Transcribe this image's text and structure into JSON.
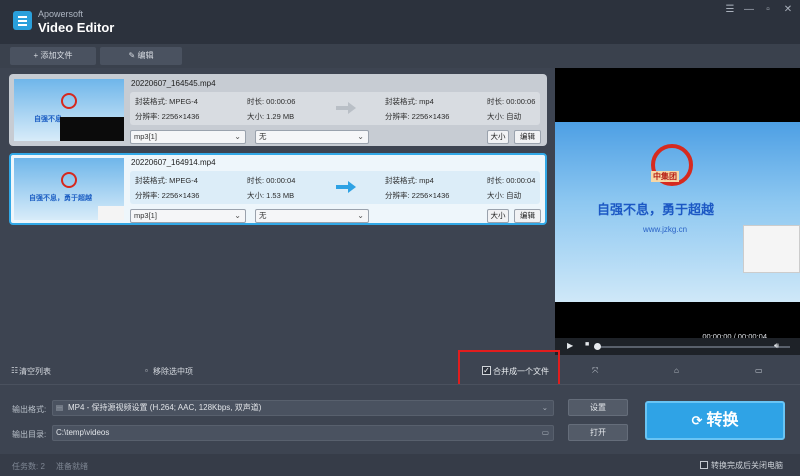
{
  "app": {
    "brand": "Apowersoft",
    "title": "Video Editor"
  },
  "window": {
    "minimize": "—",
    "restore": "▫",
    "close": "✕",
    "menu": "☰"
  },
  "toolbar": {
    "add_files": "+ 添加文件",
    "edit": "✎ 编辑"
  },
  "files": [
    {
      "name": "20220607_164545.mp4",
      "src_format_label": "封装格式: MPEG-4",
      "src_duration": "时长: 00:00:06",
      "src_resolution": "分辨率: 2256×1436",
      "src_size": "大小: 1.29 MB",
      "out_format_label": "封装格式: mp4",
      "out_duration": "时长: 00:00:06",
      "out_resolution": "分辨率: 2256×1436",
      "out_size": "大小: 自动",
      "audio": "mp3[1]",
      "subtitle": "无",
      "size_btn": "大小",
      "edit_btn": "编辑",
      "thumb_slogan": "自强不息",
      "selected": false
    },
    {
      "name": "20220607_164914.mp4",
      "src_format_label": "封装格式: MPEG-4",
      "src_duration": "时长: 00:00:04",
      "src_resolution": "分辨率: 2256×1436",
      "src_size": "大小: 1.53 MB",
      "out_format_label": "封装格式: mp4",
      "out_duration": "时长: 00:00:04",
      "out_resolution": "分辨率: 2256×1436",
      "out_size": "大小: 自动",
      "audio": "mp3[1]",
      "subtitle": "无",
      "size_btn": "大小",
      "edit_btn": "编辑",
      "thumb_slogan": "自强不息，勇于超越",
      "selected": true
    }
  ],
  "preview": {
    "logo_text": "中集团",
    "slogan": "自强不息，勇于超越",
    "url": "www.jzkg.cn",
    "time": "00:00:00 / 00:00:04",
    "progress": 0.0
  },
  "actions": {
    "clear_list": "清空列表",
    "remove_selected": "移除选中项",
    "merge_label": "合并成一个文件",
    "merge_checked": true
  },
  "output": {
    "format_label": "输出格式:",
    "format_value": "MP4 - 保持源视频设置 (H.264; AAC, 128Kbps, 双声道)",
    "dir_label": "输出目录:",
    "dir_value": "C:\\temp\\videos",
    "settings_btn": "设置",
    "open_btn": "打开",
    "convert_btn": "转换"
  },
  "status": {
    "task_count": "任务数: 2",
    "ready": "准备就绪",
    "shutdown_label": "转换完成后关闭电脑",
    "shutdown_checked": false
  },
  "colors": {
    "accent": "#2fa3e6",
    "highlight_box": "#e21d1d",
    "panel": "#3d4451"
  }
}
